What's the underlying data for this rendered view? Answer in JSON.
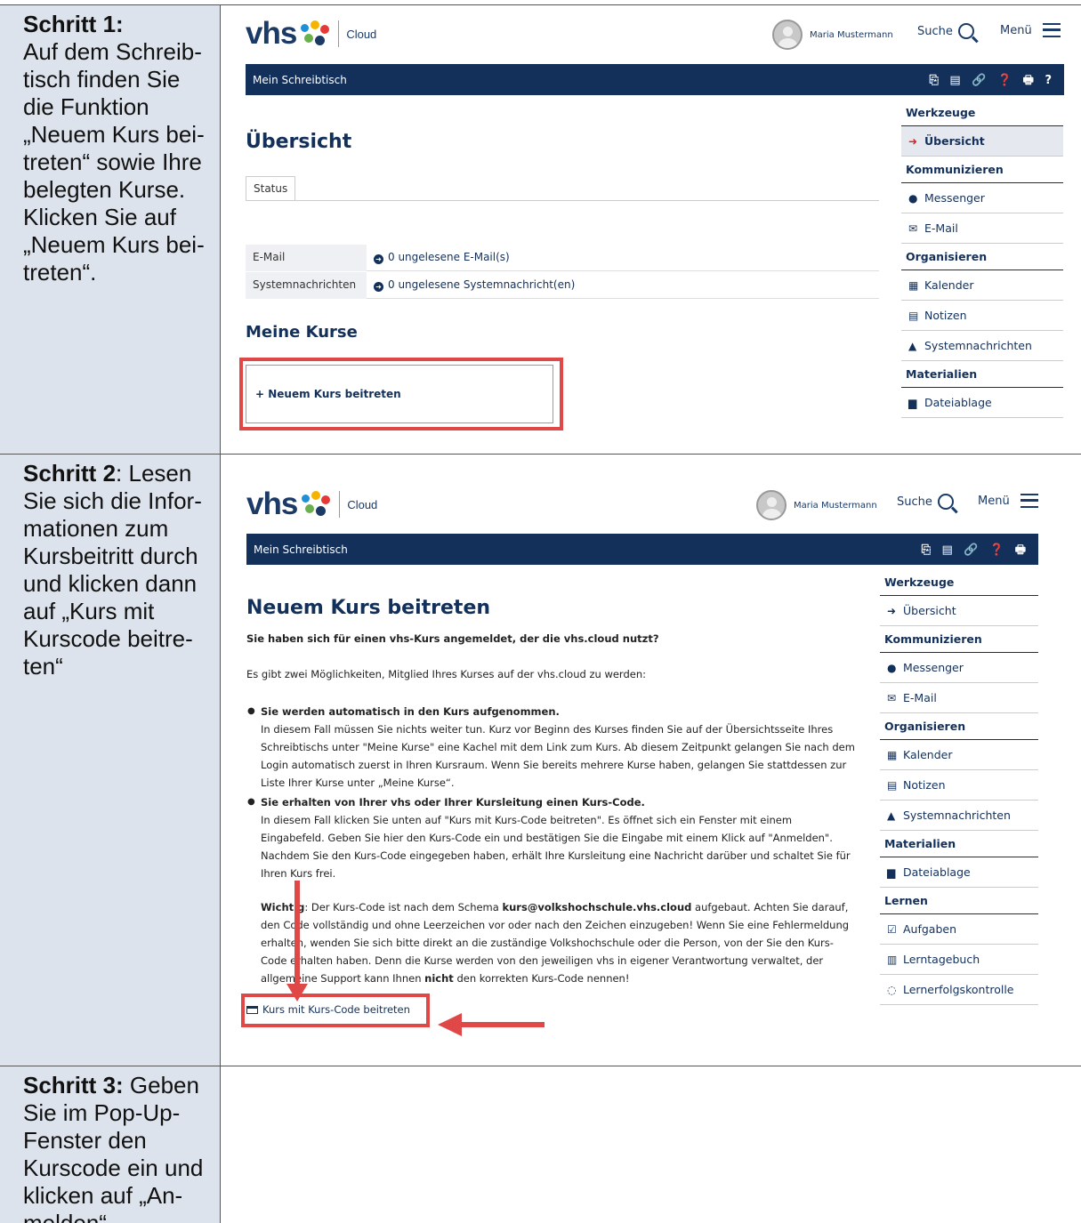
{
  "rows": [
    {
      "step_label": "Schritt 1:",
      "step_text": "Auf dem Schreib-tisch finden Sie die Funktion „Neuem Kurs bei-treten“ sowie Ihre belegten Kurse. Klicken Sie auf „Neuem Kurs bei-treten“."
    },
    {
      "step_label": "Schritt 2",
      "step_text": ": Lesen Sie sich die Infor-mationen zum Kursbeitritt durch und klicken dann auf „Kurs mit Kurscode beitre-ten“"
    },
    {
      "step_label": "Schritt 3:",
      "step_text": " Geben Sie im Pop-Up-Fenster den Kurscode ein und klicken auf „An-melden“."
    }
  ],
  "app": {
    "logo": "vhs",
    "logo_sub": "Cloud",
    "user_name": "Maria Mustermann",
    "search_label": "Suche",
    "menu_label": "Menü",
    "nav_title": "Mein Schreibtisch",
    "nav_icons_1": "⎘ ▤ 🔗 ❓ 🖶 ?",
    "nav_icons_2": "⎘ ▤ 🔗 ❓ 🖶"
  },
  "shot1": {
    "title": "Übersicht",
    "tab_status": "Status",
    "email_label": "E-Mail",
    "email_value": "0 ungelesene E-Mail(s)",
    "sys_label": "Systemnachrichten",
    "sys_value": "0 ungelesene Systemnachricht(en)",
    "courses_title": "Meine Kurse",
    "join_tile": "+ Neuem Kurs beitreten"
  },
  "sidebar1": {
    "werkzeuge": "Werkzeuge",
    "uebersicht": "Übersicht",
    "kommunizieren": "Kommunizieren",
    "messenger": "Messenger",
    "email": "E-Mail",
    "organisieren": "Organisieren",
    "kalender": "Kalender",
    "notizen": "Notizen",
    "systemnachrichten": "Systemnachrichten",
    "materialien": "Materialien",
    "dateiablage": "Dateiablage"
  },
  "shot2": {
    "title": "Neuem Kurs beitreten",
    "lead": "Sie haben sich für einen vhs-Kurs angemeldet, der die vhs.cloud nutzt?",
    "intro": "Es gibt zwei Möglichkeiten, Mitglied Ihres Kurses auf der vhs.cloud zu werden:",
    "b1_title": "Sie werden automatisch in den Kurs aufgenommen.",
    "b1_text": "In diesem Fall müssen Sie nichts weiter tun. Kurz vor Beginn des Kurses finden Sie auf der Übersichtsseite Ihres Schreibtischs unter \"Meine Kurse\" eine Kachel mit dem Link zum Kurs. Ab diesem Zeitpunkt gelangen Sie nach dem Login automatisch zuerst in Ihren Kursraum. Wenn Sie bereits mehrere Kurse haben, gelangen Sie stattdessen zur Liste Ihrer Kurse unter „Meine Kurse“.",
    "b2_title": "Sie erhalten von Ihrer vhs oder Ihrer Kursleitung einen Kurs-Code.",
    "b2_text": "In diesem Fall klicken Sie unten auf \"Kurs mit Kurs-Code beitreten\". Es öffnet sich ein Fenster mit einem Eingabefeld. Geben Sie hier den Kurs-Code ein und bestätigen Sie die Eingabe mit einem Klick auf \"Anmelden\". Nachdem Sie den Kurs-Code eingegeben haben, erhält Ihre Kursleitung eine Nachricht darüber und schaltet Sie für Ihren Kurs frei.",
    "w_label": "Wichtig",
    "w_text1": ": Der Kurs-Code ist nach dem Schema ",
    "w_code": "kurs@volkshochschule.vhs.cloud",
    "w_text2": " aufgebaut. Achten Sie darauf, den Code vollständig und ohne Leerzeichen vor oder nach den Zeichen einzugeben! Wenn Sie eine Fehlermeldung erhalten, wenden Sie sich bitte direkt an die zuständige Volkshochschule oder die Person, von der Sie den Kurs-Code erhalten haben. Denn die Kurse werden von den jeweiligen vhs in eigener Verantwortung verwaltet, der allgemeine Support kann Ihnen ",
    "w_nicht": "nicht",
    "w_text3": " den korrekten Kurs-Code nennen!",
    "join_button": "Kurs mit Kurs-Code beitreten"
  },
  "sidebar2": {
    "werkzeuge": "Werkzeuge",
    "uebersicht": "Übersicht",
    "kommunizieren": "Kommunizieren",
    "messenger": "Messenger",
    "email": "E-Mail",
    "organisieren": "Organisieren",
    "kalender": "Kalender",
    "notizen": "Notizen",
    "systemnachrichten": "Systemnachrichten",
    "materialien": "Materialien",
    "dateiablage": "Dateiablage",
    "lernen": "Lernen",
    "aufgaben": "Aufgaben",
    "lerntagebuch": "Lerntagebuch",
    "lernerfolgskontrolle": "Lernerfolgskontrolle"
  },
  "colors": {
    "navy": "#13305b",
    "highlight": "#e04848",
    "left_bg": "#dde3ec"
  }
}
